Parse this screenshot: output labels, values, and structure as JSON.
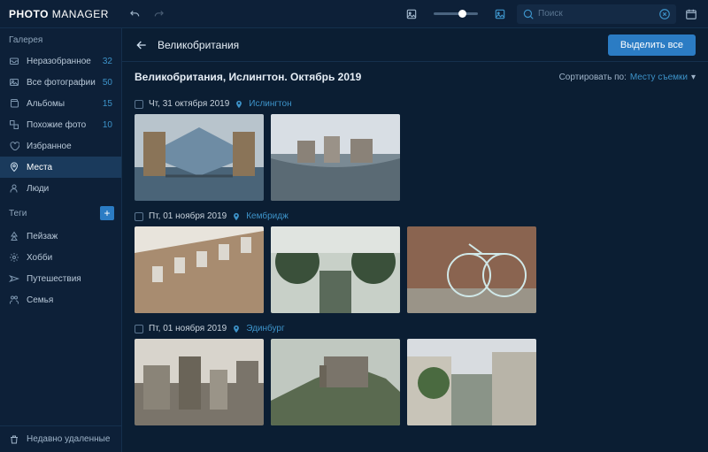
{
  "app": {
    "logo_bold": "PHOTO",
    "logo_light": " MANAGER"
  },
  "topbar": {
    "search_placeholder": "Поиск"
  },
  "sidebar": {
    "section_gallery": "Галерея",
    "section_tags": "Теги",
    "items": [
      {
        "icon": "inbox",
        "label": "Неразобранное",
        "count": "32"
      },
      {
        "icon": "photos",
        "label": "Все фотографии",
        "count": "50"
      },
      {
        "icon": "albums",
        "label": "Альбомы",
        "count": "15"
      },
      {
        "icon": "similar",
        "label": "Похожие фото",
        "count": "10"
      },
      {
        "icon": "heart",
        "label": "Избранное",
        "count": ""
      },
      {
        "icon": "pin",
        "label": "Места",
        "count": "",
        "active": true
      },
      {
        "icon": "people",
        "label": "Люди",
        "count": ""
      }
    ],
    "tags": [
      {
        "icon": "tree",
        "label": "Пейзаж"
      },
      {
        "icon": "hobby",
        "label": "Хобби"
      },
      {
        "icon": "travel",
        "label": "Путешествия"
      },
      {
        "icon": "family",
        "label": "Семья"
      }
    ],
    "trash_label": "Недавно удаленные"
  },
  "main": {
    "breadcrumb": "Великобритания",
    "select_all_label": "Выделить все",
    "subtitle": "Великобритания, Ислингтон. Октябрь 2019",
    "sort_label": "Сортировать по:",
    "sort_value": "Месту съемки",
    "groups": [
      {
        "date": "Чт, 31 октября 2019",
        "location": "Ислингтон",
        "photo_count": 2
      },
      {
        "date": "Пт, 01 ноября 2019",
        "location": "Кембридж",
        "photo_count": 3
      },
      {
        "date": "Пт, 01 ноября 2019",
        "location": "Эдинбург",
        "photo_count": 3
      }
    ]
  }
}
